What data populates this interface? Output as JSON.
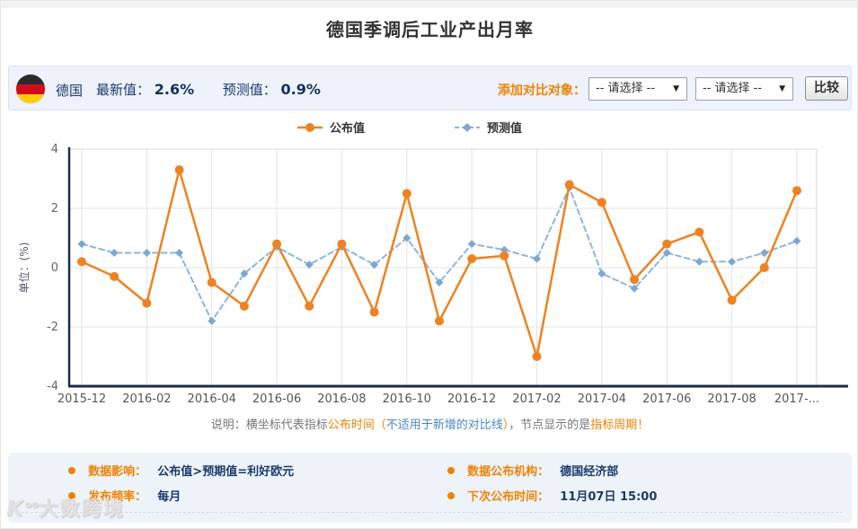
{
  "page": {
    "title": "德国季调后工业产出月率"
  },
  "header": {
    "country": "德国",
    "flag_icon": "germany-flag",
    "flag_colors": [
      "#2b2b2b",
      "#d00c1f",
      "#ffce00"
    ],
    "latest_label": "最新值：",
    "latest_value": "2.6%",
    "forecast_label": "预测值：",
    "forecast_value": "0.9%",
    "compare_label": "添加对比对象：",
    "select1_value": "-- 请选择 --",
    "select2_value": "-- 请选择 --",
    "dropdown_caret": "▼",
    "compare_button": "比较"
  },
  "chart_data": {
    "type": "line",
    "title": "",
    "ylabel": "单位：(%)",
    "ylim": [
      -4,
      4
    ],
    "y_ticks": [
      4,
      2,
      0,
      -2,
      -4
    ],
    "grid": true,
    "legend_position": "top",
    "x": [
      "2015-12",
      "2016-01",
      "2016-02",
      "2016-03",
      "2016-04",
      "2016-05",
      "2016-06",
      "2016-07",
      "2016-08",
      "2016-09",
      "2016-10",
      "2016-11",
      "2016-12",
      "2017-01",
      "2017-02",
      "2017-03",
      "2017-04",
      "2017-05",
      "2017-06",
      "2017-07",
      "2017-08",
      "2017-09",
      "2017-10"
    ],
    "x_tick_labels": [
      "2015-12",
      "2016-02",
      "2016-04",
      "2016-06",
      "2016-08",
      "2016-10",
      "2016-12",
      "2017-02",
      "2017-04",
      "2017-06",
      "2017-08",
      "2017-..."
    ],
    "series": [
      {
        "name": "公布值",
        "color": "#ef8220",
        "line_style": "solid",
        "marker": "circle",
        "values": [
          0.2,
          -0.3,
          -1.2,
          3.3,
          -0.5,
          -1.3,
          0.8,
          -1.3,
          0.8,
          -1.5,
          2.5,
          -1.8,
          0.3,
          0.4,
          -3.0,
          2.8,
          2.2,
          -0.4,
          0.8,
          1.2,
          -1.1,
          0.0,
          2.6
        ]
      },
      {
        "name": "预测值",
        "color": "#8db6de",
        "marker_color": "#7ba7d7",
        "line_style": "dashed",
        "marker": "diamond",
        "values": [
          0.8,
          0.5,
          0.5,
          0.5,
          -1.8,
          -0.2,
          0.7,
          0.1,
          0.7,
          0.1,
          1.0,
          -0.5,
          0.8,
          0.6,
          0.3,
          2.7,
          -0.2,
          -0.7,
          0.5,
          0.2,
          0.2,
          0.5,
          0.9
        ]
      }
    ]
  },
  "note": {
    "segments": [
      {
        "text": "说明：横坐标代表指标",
        "cls": "c-gray"
      },
      {
        "text": "公布时间",
        "cls": "c-orange"
      },
      {
        "text": "（",
        "cls": "c-orange"
      },
      {
        "text": "不适用于新增的对比线",
        "cls": "c-blue"
      },
      {
        "text": "）",
        "cls": "c-orange"
      },
      {
        "text": "，节点显示的是",
        "cls": "c-gray"
      },
      {
        "text": "指标周期！",
        "cls": "c-orange"
      }
    ]
  },
  "footer": {
    "items": [
      {
        "label": "数据影响：",
        "value": "公布值>预期值=利好欧元"
      },
      {
        "label": "发布频率：",
        "value": "每月"
      },
      {
        "label": "数据公布机构：",
        "value": "德国经济部"
      },
      {
        "label": "下次公布时间：",
        "value": "11月07日 15:00"
      }
    ]
  },
  "watermark": {
    "text": "大数跨境"
  }
}
